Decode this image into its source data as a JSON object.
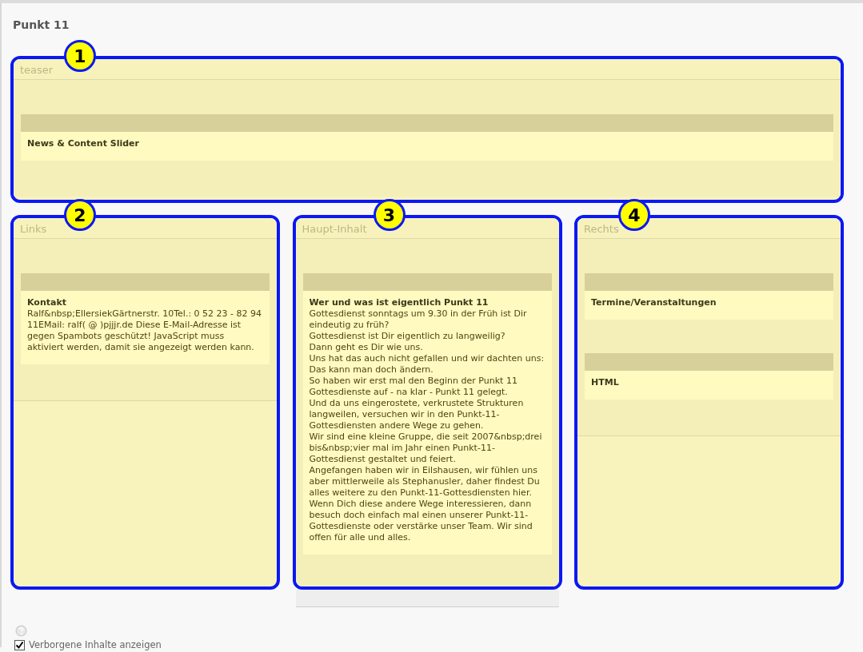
{
  "page_title": "Punkt 11",
  "teaser": {
    "marker": "1",
    "label": "teaser",
    "elements": [
      {
        "title": "News & Content Slider"
      }
    ]
  },
  "columns": [
    {
      "marker": "2",
      "label": "Links",
      "footer_bar": false,
      "elements": [
        {
          "title": "Kontakt",
          "paragraphs": [
            "Ralf&nbsp;EllersiekGärtnerstr. 10Tel.: 0 52 23 - 82 94 11EMail: ralf( @ )pjjjr.de Diese E-Mail-Adresse ist gegen Spambots geschützt! JavaScript muss aktiviert werden, damit sie angezeigt werden kann."
          ]
        }
      ]
    },
    {
      "marker": "3",
      "label": "Haupt-Inhalt",
      "footer_bar": true,
      "elements": [
        {
          "title": "Wer und was ist eigentlich Punkt 11",
          "paragraphs": [
            "Gottesdienst sonntags um 9.30 in der Früh ist Dir eindeutig zu früh?",
            "Gottesdienst ist Dir eigentlich zu langweilig?",
            "Dann geht es Dir wie uns.",
            "Uns hat das auch nicht gefallen und wir dachten uns: Das kann man doch ändern.",
            "So haben wir erst mal den Beginn der Punkt 11 Gottesdienste auf - na klar - Punkt 11 gelegt.",
            "Und da uns eingerostete, verkrustete Strukturen langweilen, versuchen wir in den Punkt-11-Gottesdiensten andere Wege zu gehen.",
            "Wir sind eine kleine Gruppe, die seit 2007&nbsp;drei bis&nbsp;vier mal im Jahr einen Punkt-11-Gottesdienst gestaltet und feiert.",
            "Angefangen haben wir in Eilshausen, wir fühlen uns aber mittlerweile als Stephanusler, daher findest Du alles weitere zu den Punkt-11-Gottesdiensten hier.",
            "Wenn Dich diese andere Wege interessieren, dann besuch doch einfach mal einen unserer Punkt-11-Gottesdienste oder verstärke unser Team. Wir sind offen für alle und alles."
          ]
        }
      ]
    },
    {
      "marker": "4",
      "label": "Rechts",
      "footer_bar": false,
      "elements": [
        {
          "title": "Termine/Veranstaltungen"
        },
        {
          "title": "HTML"
        }
      ]
    }
  ],
  "hidden_toggle": {
    "label": "Verborgene Inhalte anzeigen",
    "checked": true
  }
}
